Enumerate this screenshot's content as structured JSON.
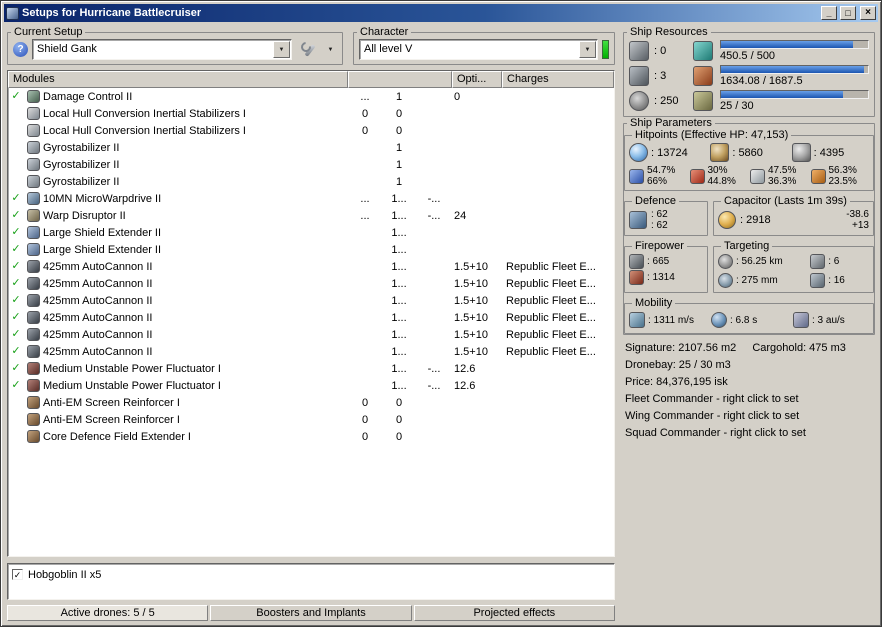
{
  "window": {
    "title": "Setups for Hurricane Battlecruiser"
  },
  "glyphs": {
    "minimize": "_",
    "maximize": "□",
    "close": "×",
    "dropdown": "▼",
    "help": "?"
  },
  "setup": {
    "label": "Current Setup",
    "value": "Shield Gank"
  },
  "character": {
    "label": "Character",
    "value": "All level V"
  },
  "modules": {
    "headers": {
      "modules": "Modules",
      "blank": "",
      "opti": "Opti...",
      "charges": "Charges"
    },
    "rows": [
      {
        "check": "✓",
        "icon": "damage-control",
        "name": "Damage Control II",
        "c1": "...",
        "c2": "1",
        "c3": "",
        "opti": "0",
        "charges": ""
      },
      {
        "check": "",
        "icon": "inertial-stab",
        "name": "Local Hull Conversion Inertial Stabilizers I",
        "c1": "0",
        "c2": "0",
        "c3": "",
        "opti": "",
        "charges": ""
      },
      {
        "check": "",
        "icon": "inertial-stab",
        "name": "Local Hull Conversion Inertial Stabilizers I",
        "c1": "0",
        "c2": "0",
        "c3": "",
        "opti": "",
        "charges": ""
      },
      {
        "check": "",
        "icon": "gyrostabilizer",
        "name": "Gyrostabilizer II",
        "c1": "",
        "c2": "1",
        "c3": "",
        "opti": "",
        "charges": ""
      },
      {
        "check": "",
        "icon": "gyrostabilizer",
        "name": "Gyrostabilizer II",
        "c1": "",
        "c2": "1",
        "c3": "",
        "opti": "",
        "charges": ""
      },
      {
        "check": "",
        "icon": "gyrostabilizer",
        "name": "Gyrostabilizer II",
        "c1": "",
        "c2": "1",
        "c3": "",
        "opti": "",
        "charges": ""
      },
      {
        "check": "✓",
        "icon": "microwarpdrive",
        "name": "10MN MicroWarpdrive II",
        "c1": "...",
        "c2": "1...",
        "c3": "-...",
        "opti": "",
        "charges": ""
      },
      {
        "check": "✓",
        "icon": "warp-disruptor",
        "name": "Warp Disruptor II",
        "c1": "...",
        "c2": "1...",
        "c3": "-...",
        "opti": "24",
        "charges": ""
      },
      {
        "check": "✓",
        "icon": "shield-extender",
        "name": "Large Shield Extender II",
        "c1": "",
        "c2": "1...",
        "c3": "",
        "opti": "",
        "charges": ""
      },
      {
        "check": "✓",
        "icon": "shield-extender",
        "name": "Large Shield Extender II",
        "c1": "",
        "c2": "1...",
        "c3": "",
        "opti": "",
        "charges": ""
      },
      {
        "check": "✓",
        "icon": "autocannon",
        "name": "425mm AutoCannon II",
        "c1": "",
        "c2": "1...",
        "c3": "",
        "opti": "1.5+10",
        "charges": "Republic Fleet E..."
      },
      {
        "check": "✓",
        "icon": "autocannon",
        "name": "425mm AutoCannon II",
        "c1": "",
        "c2": "1...",
        "c3": "",
        "opti": "1.5+10",
        "charges": "Republic Fleet E..."
      },
      {
        "check": "✓",
        "icon": "autocannon",
        "name": "425mm AutoCannon II",
        "c1": "",
        "c2": "1...",
        "c3": "",
        "opti": "1.5+10",
        "charges": "Republic Fleet E..."
      },
      {
        "check": "✓",
        "icon": "autocannon",
        "name": "425mm AutoCannon II",
        "c1": "",
        "c2": "1...",
        "c3": "",
        "opti": "1.5+10",
        "charges": "Republic Fleet E..."
      },
      {
        "check": "✓",
        "icon": "autocannon",
        "name": "425mm AutoCannon II",
        "c1": "",
        "c2": "1...",
        "c3": "",
        "opti": "1.5+10",
        "charges": "Republic Fleet E..."
      },
      {
        "check": "✓",
        "icon": "autocannon",
        "name": "425mm AutoCannon II",
        "c1": "",
        "c2": "1...",
        "c3": "",
        "opti": "1.5+10",
        "charges": "Republic Fleet E..."
      },
      {
        "check": "✓",
        "icon": "neutralizer",
        "name": "Medium Unstable Power Fluctuator I",
        "c1": "",
        "c2": "1...",
        "c3": "-...",
        "opti": "12.6",
        "charges": ""
      },
      {
        "check": "✓",
        "icon": "neutralizer",
        "name": "Medium Unstable Power Fluctuator I",
        "c1": "",
        "c2": "1...",
        "c3": "-...",
        "opti": "12.6",
        "charges": ""
      },
      {
        "check": "",
        "icon": "rig",
        "name": "Anti-EM Screen Reinforcer I",
        "c1": "0",
        "c2": "0",
        "c3": "",
        "opti": "",
        "charges": ""
      },
      {
        "check": "",
        "icon": "rig",
        "name": "Anti-EM Screen Reinforcer I",
        "c1": "0",
        "c2": "0",
        "c3": "",
        "opti": "",
        "charges": ""
      },
      {
        "check": "",
        "icon": "rig",
        "name": "Core Defence Field Extender I",
        "c1": "0",
        "c2": "0",
        "c3": "",
        "opti": "",
        "charges": ""
      }
    ]
  },
  "drones": {
    "items": [
      {
        "checked": "✓",
        "name": "Hobgoblin II x5"
      }
    ]
  },
  "bottom_bar": {
    "items": [
      {
        "label": "Active drones: 5 / 5",
        "state": "tab-active"
      },
      {
        "label": "Boosters and Implants",
        "state": "tab-normal"
      },
      {
        "label": "Projected effects",
        "state": "tab-normal"
      }
    ]
  },
  "ship_resources": {
    "label": "Ship Resources",
    "rows": [
      {
        "slot_icon": "turret-hardpoints",
        "slot_value": ": 0",
        "res_icon": "cpu",
        "bar_text": "450.5 / 500",
        "bar_pct": 90
      },
      {
        "slot_icon": "launcher-hardpoints",
        "slot_value": ": 3",
        "res_icon": "powergrid",
        "bar_text": "1634.08 / 1687.5",
        "bar_pct": 97
      },
      {
        "slot_icon": "calibration",
        "slot_value": ": 250",
        "res_icon": "upgrade-capacity",
        "bar_text": "25 / 30",
        "bar_pct": 83
      }
    ]
  },
  "ship_parameters": {
    "label": "Ship Parameters",
    "hitpoints": {
      "label": "Hitpoints (Effective HP: 47,153)",
      "pools": [
        {
          "icon": "shield",
          "value": ": 13724"
        },
        {
          "icon": "armor",
          "value": ": 5860"
        },
        {
          "icon": "structure",
          "value": ": 4395"
        }
      ],
      "resists": [
        {
          "icon": "em-resist",
          "top": "54.7%",
          "bottom": "66%"
        },
        {
          "icon": "thermal-resist",
          "top": "30%",
          "bottom": "44.8%"
        },
        {
          "icon": "kinetic-resist",
          "top": "47.5%",
          "bottom": "36.3%"
        },
        {
          "icon": "explosive-resist",
          "top": "56.3%",
          "bottom": "23.5%"
        }
      ]
    },
    "defence": {
      "label": "Defence",
      "values": [
        {
          "text": ": 62"
        },
        {
          "text": ": 62"
        }
      ]
    },
    "capacitor": {
      "label": "Capacitor (Lasts 1m 39s)",
      "value": ": 2918",
      "delta_top": "-38.6",
      "delta_bottom": "+13"
    },
    "firepower": {
      "label": "Firepower",
      "rows": [
        {
          "icon": "volley-damage",
          "value": ": 665"
        },
        {
          "icon": "dps",
          "value": ": 1314"
        }
      ]
    },
    "targeting": {
      "label": "Targeting",
      "cells": [
        {
          "icon": "targeting-range",
          "value": ": 56.25 km"
        },
        {
          "icon": "max-targets",
          "value": ": 6"
        },
        {
          "icon": "scan-resolution",
          "value": ": 275 mm"
        },
        {
          "icon": "sensor-strength",
          "value": ": 16"
        }
      ]
    },
    "mobility": {
      "label": "Mobility",
      "cells": [
        {
          "icon": "max-velocity",
          "value": ": 1311 m/s"
        },
        {
          "icon": "align-time",
          "value": ": 6.8 s"
        },
        {
          "icon": "warp-speed",
          "value": ": 3 au/s"
        }
      ]
    }
  },
  "summary": {
    "signature": "Signature: 2107.56 m2",
    "cargohold": "Cargohold: 475 m3",
    "lines": [
      {
        "text": "Dronebay: 25 / 30 m3"
      },
      {
        "text": "Price: 84,376,195 isk"
      },
      {
        "text": "Fleet Commander - right click to set"
      },
      {
        "text": "Wing Commander - right click to set"
      },
      {
        "text": "Squad Commander - right click to set"
      }
    ]
  }
}
